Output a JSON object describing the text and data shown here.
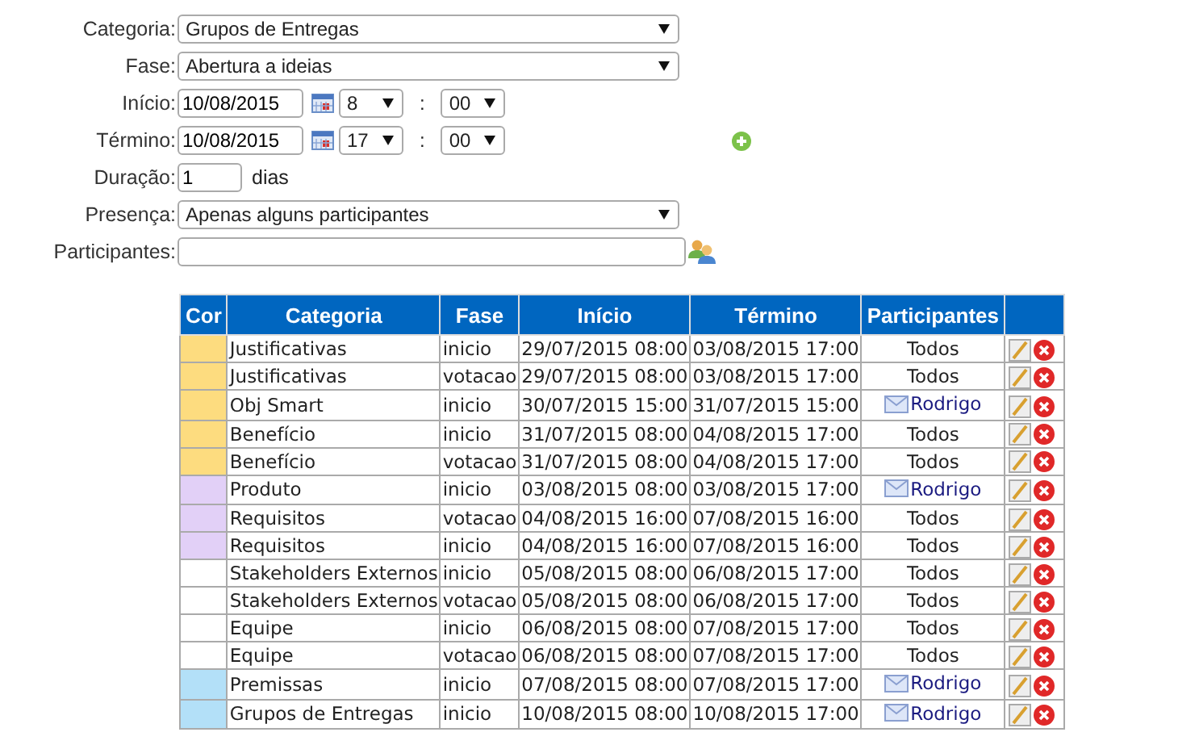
{
  "form": {
    "categoria": {
      "label": "Categoria:",
      "value": "Grupos de Entregas"
    },
    "fase": {
      "label": "Fase:",
      "value": "Abertura a ideias"
    },
    "inicio": {
      "label": "Início:",
      "date": "10/08/2015",
      "hour": "8",
      "minute": "00",
      "separator": ":"
    },
    "termino": {
      "label": "Término:",
      "date": "10/08/2015",
      "hour": "17",
      "minute": "00",
      "separator": ":"
    },
    "duracao": {
      "label": "Duração:",
      "value": "1",
      "unit": "dias"
    },
    "presenca": {
      "label": "Presença:",
      "value": "Apenas alguns participantes"
    },
    "participantes": {
      "label": "Participantes:"
    }
  },
  "table": {
    "columns": [
      "Cor",
      "Categoria",
      "Fase",
      "Início",
      "Término",
      "Participantes"
    ],
    "rows": [
      {
        "color": "#fddc7f",
        "categoria": "Justificativas",
        "fase": "inicio",
        "inicio": "29/07/2015 08:00",
        "termino": "03/08/2015 17:00",
        "participantes": {
          "kind": "group",
          "text": "Todos"
        }
      },
      {
        "color": "#fddc7f",
        "categoria": "Justificativas",
        "fase": "votacao",
        "inicio": "29/07/2015 08:00",
        "termino": "03/08/2015 17:00",
        "participantes": {
          "kind": "group",
          "text": "Todos"
        }
      },
      {
        "color": "#fddc7f",
        "categoria": "Obj Smart",
        "fase": "inicio",
        "inicio": "30/07/2015 15:00",
        "termino": "31/07/2015 15:00",
        "participantes": {
          "kind": "person",
          "text": "Rodrigo"
        }
      },
      {
        "color": "#fddc7f",
        "categoria": "Benefício",
        "fase": "inicio",
        "inicio": "31/07/2015 08:00",
        "termino": "04/08/2015 17:00",
        "participantes": {
          "kind": "group",
          "text": "Todos"
        }
      },
      {
        "color": "#fddc7f",
        "categoria": "Benefício",
        "fase": "votacao",
        "inicio": "31/07/2015 08:00",
        "termino": "04/08/2015 17:00",
        "participantes": {
          "kind": "group",
          "text": "Todos"
        }
      },
      {
        "color": "#e2d0f7",
        "categoria": "Produto",
        "fase": "inicio",
        "inicio": "03/08/2015 08:00",
        "termino": "03/08/2015 17:00",
        "participantes": {
          "kind": "person",
          "text": "Rodrigo"
        }
      },
      {
        "color": "#e2d0f7",
        "categoria": "Requisitos",
        "fase": "votacao",
        "inicio": "04/08/2015 16:00",
        "termino": "07/08/2015 16:00",
        "participantes": {
          "kind": "group",
          "text": "Todos"
        }
      },
      {
        "color": "#e2d0f7",
        "categoria": "Requisitos",
        "fase": "inicio",
        "inicio": "04/08/2015 16:00",
        "termino": "07/08/2015 16:00",
        "participantes": {
          "kind": "group",
          "text": "Todos"
        }
      },
      {
        "color": "#ffffff",
        "categoria": "Stakeholders Externos",
        "fase": "inicio",
        "inicio": "05/08/2015 08:00",
        "termino": "06/08/2015 17:00",
        "participantes": {
          "kind": "group",
          "text": "Todos"
        }
      },
      {
        "color": "#ffffff",
        "categoria": "Stakeholders Externos",
        "fase": "votacao",
        "inicio": "05/08/2015 08:00",
        "termino": "06/08/2015 17:00",
        "participantes": {
          "kind": "group",
          "text": "Todos"
        }
      },
      {
        "color": "#ffffff",
        "categoria": "Equipe",
        "fase": "inicio",
        "inicio": "06/08/2015 08:00",
        "termino": "07/08/2015 17:00",
        "participantes": {
          "kind": "group",
          "text": "Todos"
        }
      },
      {
        "color": "#ffffff",
        "categoria": "Equipe",
        "fase": "votacao",
        "inicio": "06/08/2015 08:00",
        "termino": "07/08/2015 17:00",
        "participantes": {
          "kind": "group",
          "text": "Todos"
        }
      },
      {
        "color": "#b3e0f8",
        "categoria": "Premissas",
        "fase": "inicio",
        "inicio": "07/08/2015 08:00",
        "termino": "07/08/2015 17:00",
        "participantes": {
          "kind": "person",
          "text": "Rodrigo"
        }
      },
      {
        "color": "#b3e0f8",
        "categoria": "Grupos de Entregas",
        "fase": "inicio",
        "inicio": "10/08/2015 08:00",
        "termino": "10/08/2015 17:00",
        "participantes": {
          "kind": "person",
          "text": "Rodrigo"
        }
      }
    ]
  }
}
